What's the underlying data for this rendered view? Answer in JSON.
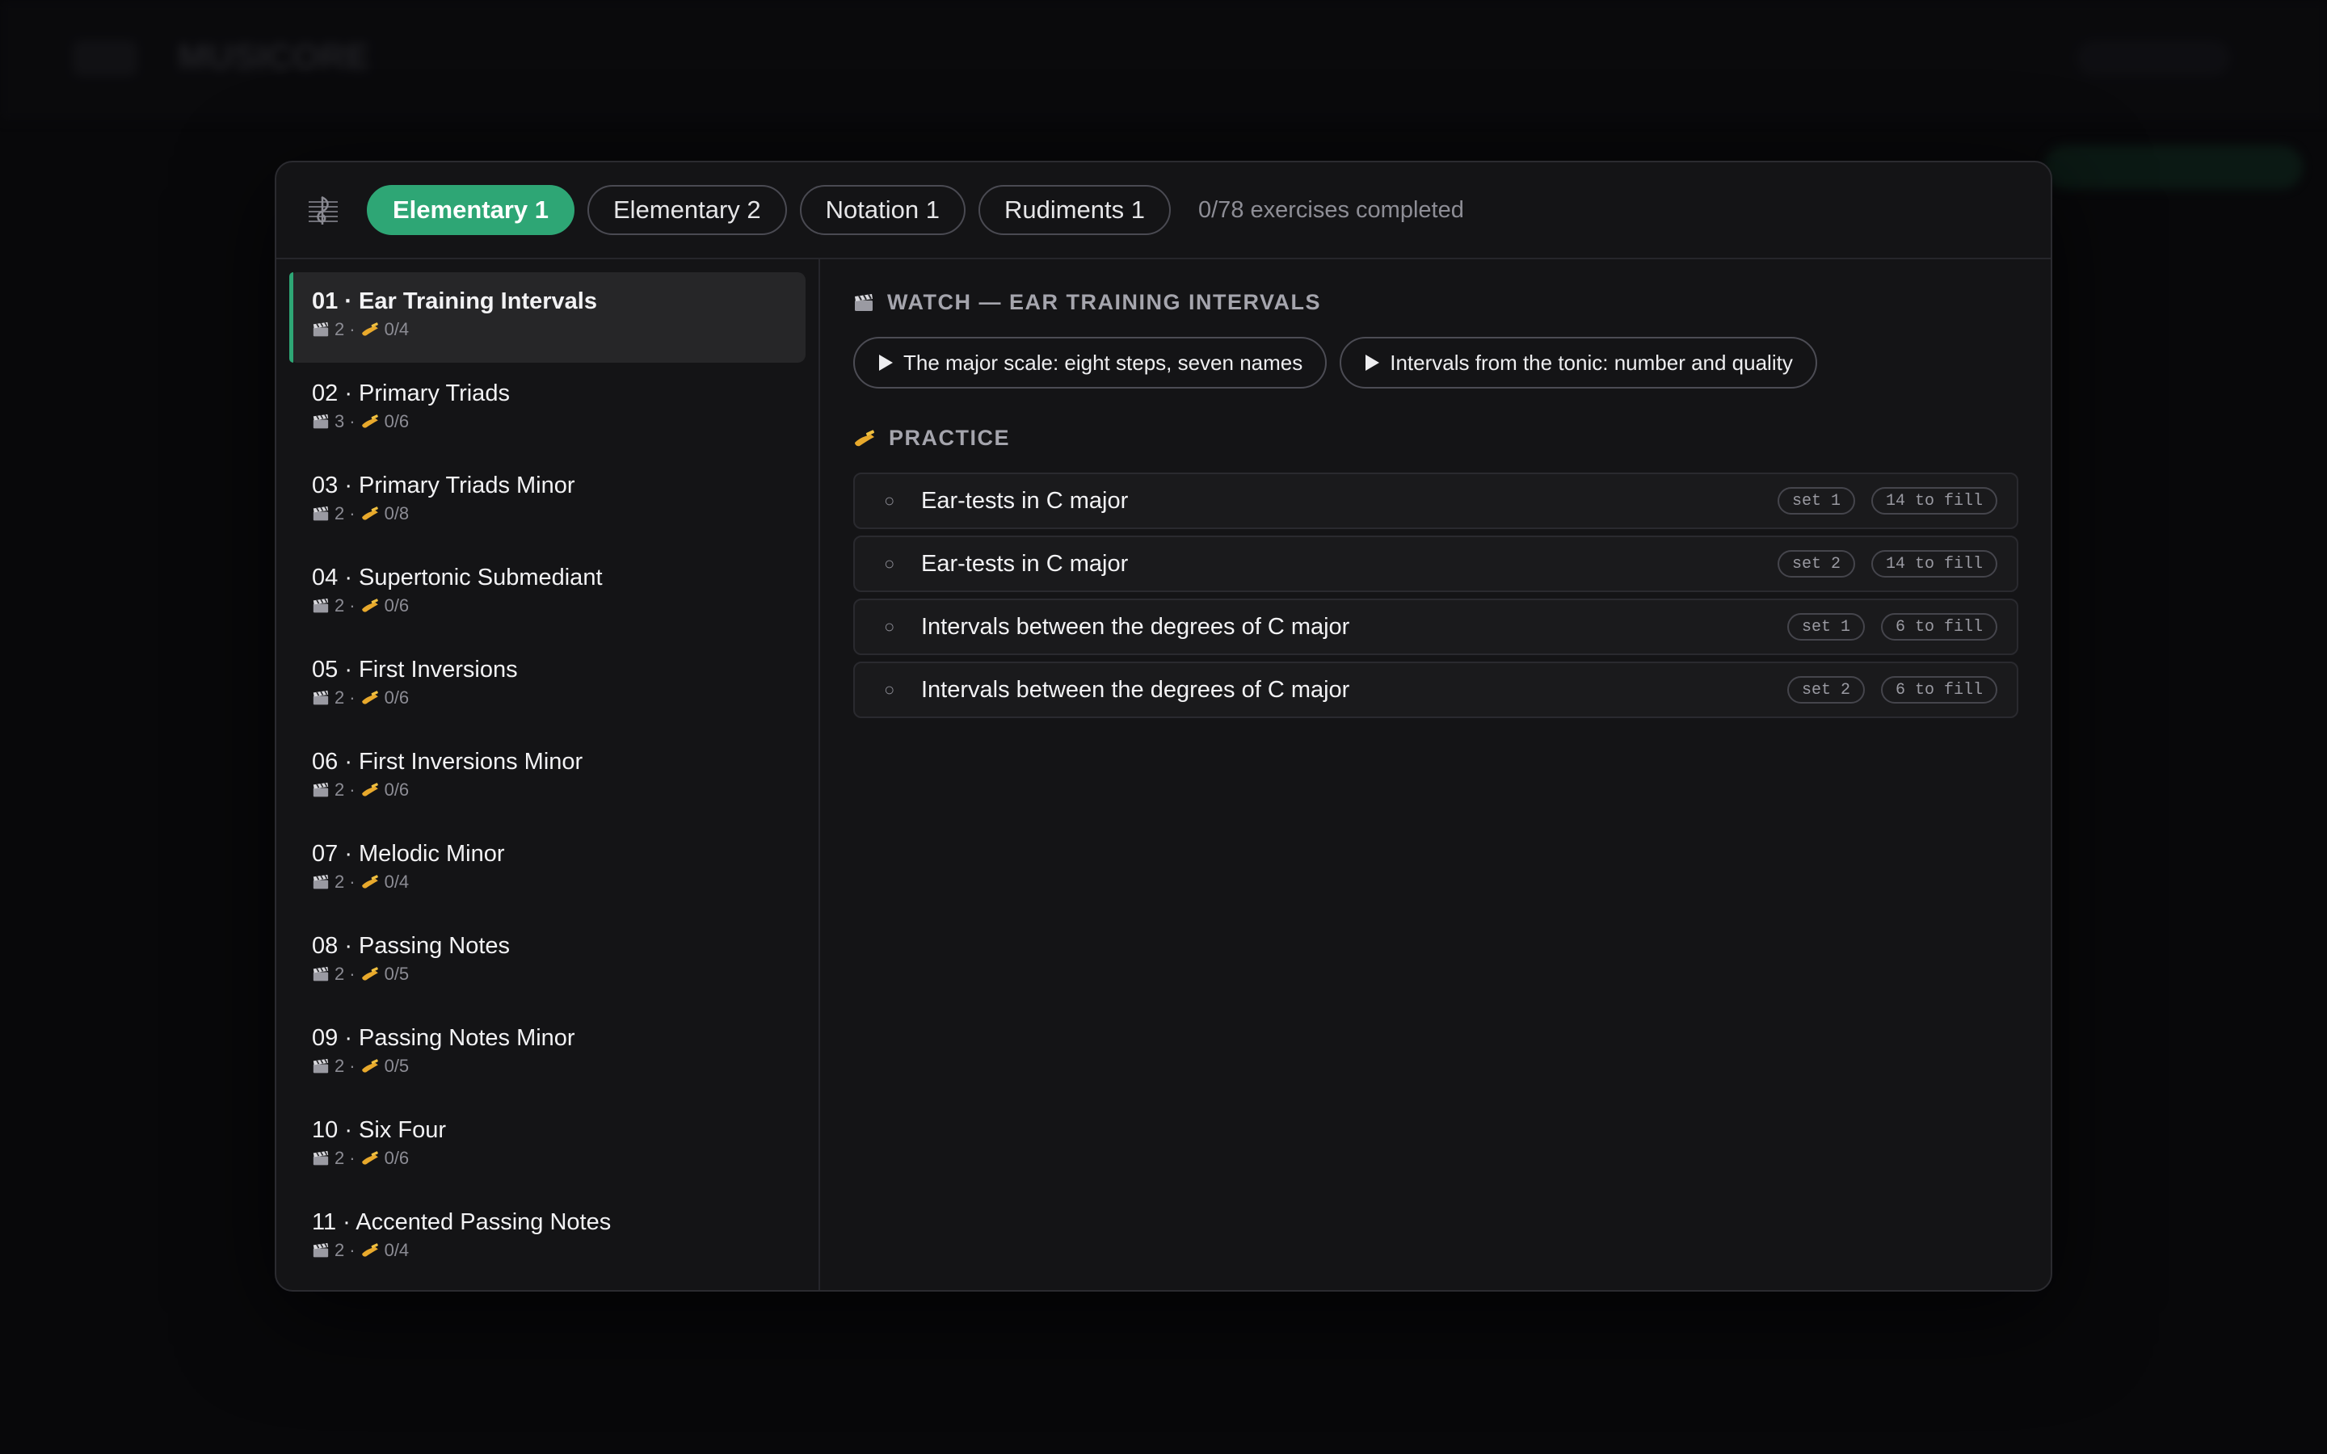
{
  "background": {
    "app_title": "MUSICORE"
  },
  "header": {
    "tabs": [
      {
        "label": "Elementary 1",
        "active": true
      },
      {
        "label": "Elementary 2",
        "active": false
      },
      {
        "label": "Notation 1",
        "active": false
      },
      {
        "label": "Rudiments 1",
        "active": false
      }
    ],
    "progress": "0/78 exercises completed"
  },
  "lessons": [
    {
      "title": "01 · Ear Training Intervals",
      "videos": "2",
      "exercises": "0/4",
      "active": true
    },
    {
      "title": "02 · Primary Triads",
      "videos": "3",
      "exercises": "0/6"
    },
    {
      "title": "03 · Primary Triads Minor",
      "videos": "2",
      "exercises": "0/8"
    },
    {
      "title": "04 · Supertonic Submediant",
      "videos": "2",
      "exercises": "0/6"
    },
    {
      "title": "05 · First Inversions",
      "videos": "2",
      "exercises": "0/6"
    },
    {
      "title": "06 · First Inversions Minor",
      "videos": "2",
      "exercises": "0/6"
    },
    {
      "title": "07 · Melodic Minor",
      "videos": "2",
      "exercises": "0/4"
    },
    {
      "title": "08 · Passing Notes",
      "videos": "2",
      "exercises": "0/5"
    },
    {
      "title": "09 · Passing Notes Minor",
      "videos": "2",
      "exercises": "0/5"
    },
    {
      "title": "10 · Six Four",
      "videos": "2",
      "exercises": "0/6"
    },
    {
      "title": "11 · Accented Passing Notes",
      "videos": "2",
      "exercises": "0/4"
    }
  ],
  "meta_separator": "·",
  "main": {
    "watch_title": "WATCH — EAR TRAINING INTERVALS",
    "videos": [
      "The major scale: eight steps, seven names",
      "Intervals from the tonic: number and quality"
    ],
    "practice_title": "PRACTICE",
    "exercises": [
      {
        "status": "○",
        "label": "Ear-tests in C major",
        "set": "set 1",
        "fill": "14 to fill"
      },
      {
        "status": "○",
        "label": "Ear-tests in C major",
        "set": "set 2",
        "fill": "14 to fill"
      },
      {
        "status": "○",
        "label": "Intervals between the degrees of C major",
        "set": "set 1",
        "fill": "6 to fill"
      },
      {
        "status": "○",
        "label": "Intervals between the degrees of C major",
        "set": "set 2",
        "fill": "6 to fill"
      }
    ]
  },
  "icons": {
    "header": "music-staff-icon",
    "watch": "clapperboard-icon",
    "practice": "writing-hand-icon",
    "play": "play-icon"
  },
  "colors": {
    "accent": "#2ea675",
    "background": "#08080a",
    "panel": "#141416"
  }
}
